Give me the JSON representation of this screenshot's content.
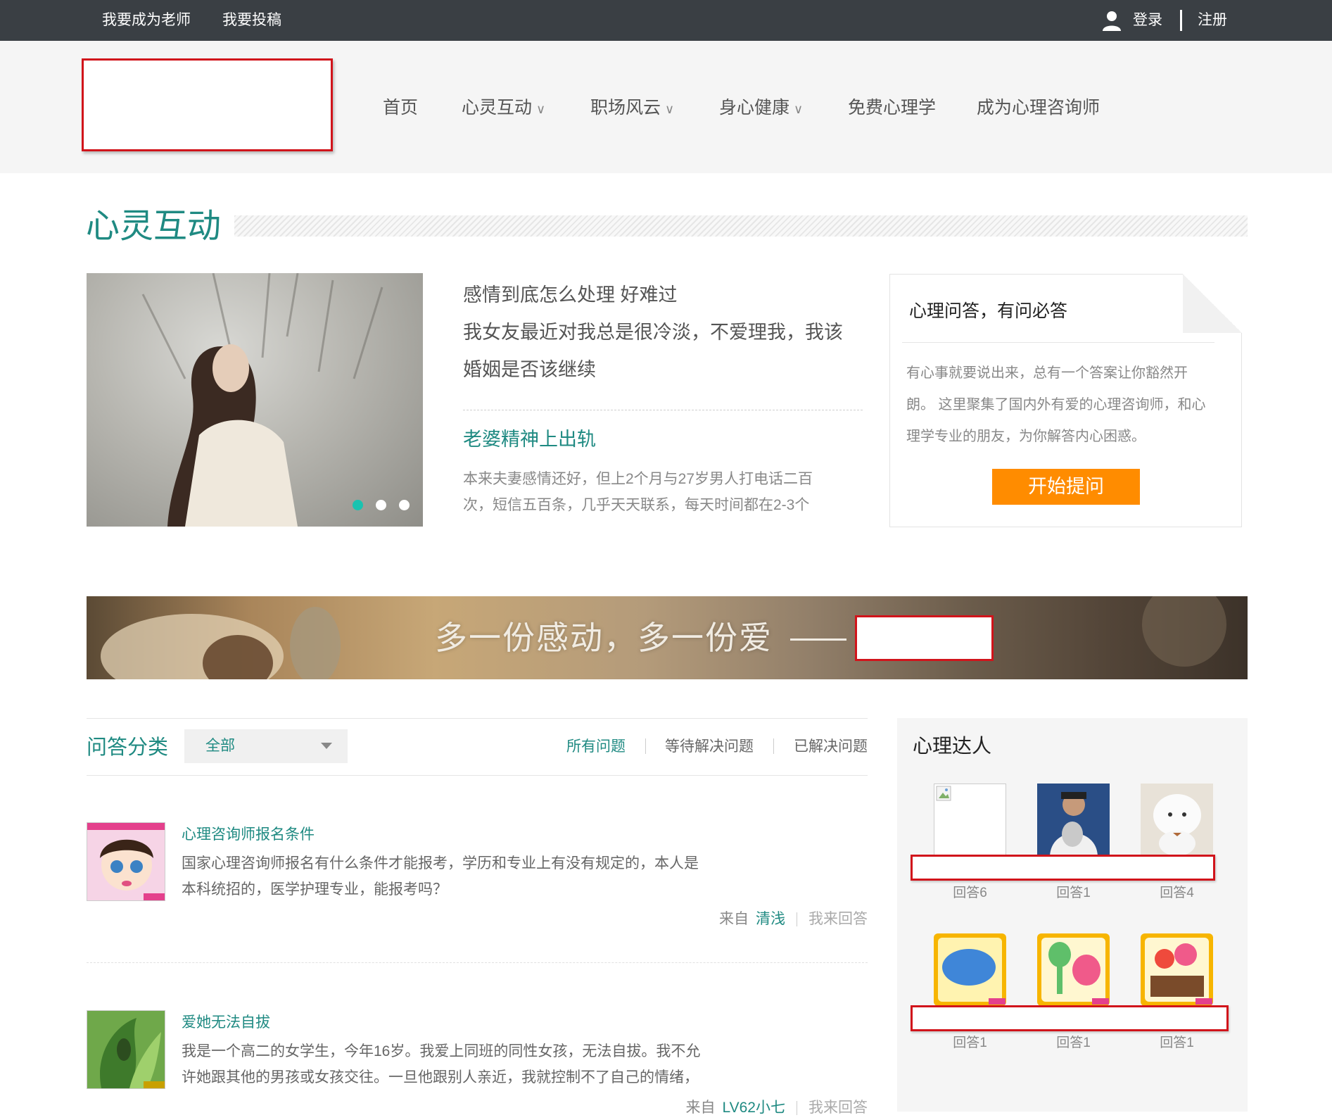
{
  "topbar": {
    "become_teacher": "我要成为老师",
    "submit_article": "我要投稿",
    "login": "登录",
    "register": "注册"
  },
  "nav": {
    "items": [
      {
        "label": "首页"
      },
      {
        "label": "心灵互动",
        "chevron": "∨"
      },
      {
        "label": "职场风云",
        "chevron": "∨"
      },
      {
        "label": "身心健康",
        "chevron": "∨"
      },
      {
        "label": "免费心理学"
      },
      {
        "label": "成为心理咨询师"
      }
    ]
  },
  "section": {
    "title": "心灵互动"
  },
  "featured": {
    "title_lines": [
      "感情到底怎么处理 好难过",
      "我女友最近对我总是很冷淡，不爱理我，我该",
      "婚姻是否该继续"
    ],
    "second_title": "老婆精神上出轨",
    "second_desc_lines": [
      "本来夫妻感情还好，但上2个月与27岁男人打电话二百",
      "次，短信五百条，几乎天天联系，每天时间都在2-3个"
    ]
  },
  "qa_card": {
    "title": "心理问答，有问必答",
    "desc_lines": [
      "有心事就要说出来，总有一个答案让你豁然开",
      "朗。 这里聚集了国内外有爱的心理咨询师，和心",
      "理学专业的朋友，为你解答内心困惑。"
    ],
    "button": "开始提问"
  },
  "banner": {
    "slogan": "多一份感动，多一份爱"
  },
  "questions_header": {
    "title": "问答分类",
    "select_value": "全部",
    "filters": [
      "所有问题",
      "等待解决问题",
      "已解决问题"
    ]
  },
  "questions": [
    {
      "title": "心理咨询师报名条件",
      "desc_lines": [
        "国家心理咨询师报名有什么条件才能报考，学历和专业上有没有规定的，本人是",
        "本科统招的，医学护理专业，能报考吗？"
      ],
      "from_label": "来自",
      "user": "清浅",
      "answer": "我来回答"
    },
    {
      "title": "爱她无法自拔",
      "desc_lines": [
        "我是一个高二的女学生，今年16岁。我爱上同班的同性女孩，无法自拔。我不允",
        "许她跟其他的男孩或女孩交往。一旦他跟别人亲近，我就控制不了自己的情绪，"
      ],
      "from_label": "来自",
      "user": "LV62小七",
      "answer": "我来回答"
    }
  ],
  "experts": {
    "title": "心理达人",
    "items": [
      {
        "label": "回答6",
        "icon": "broken-image-icon"
      },
      {
        "label": "回答1",
        "icon": "trophy-man-avatar"
      },
      {
        "label": "回答4",
        "icon": "white-toy-avatar"
      },
      {
        "label": "回答1",
        "icon": "say-club-avatar"
      },
      {
        "label": "回答1",
        "icon": "alien-avatar"
      },
      {
        "label": "回答1",
        "icon": "flowers-avatar"
      }
    ]
  },
  "colors": {
    "brand": "#1f8a82",
    "accent": "#ff8c00",
    "topbar": "#3a3f44",
    "highlight": "#19c3b0"
  }
}
